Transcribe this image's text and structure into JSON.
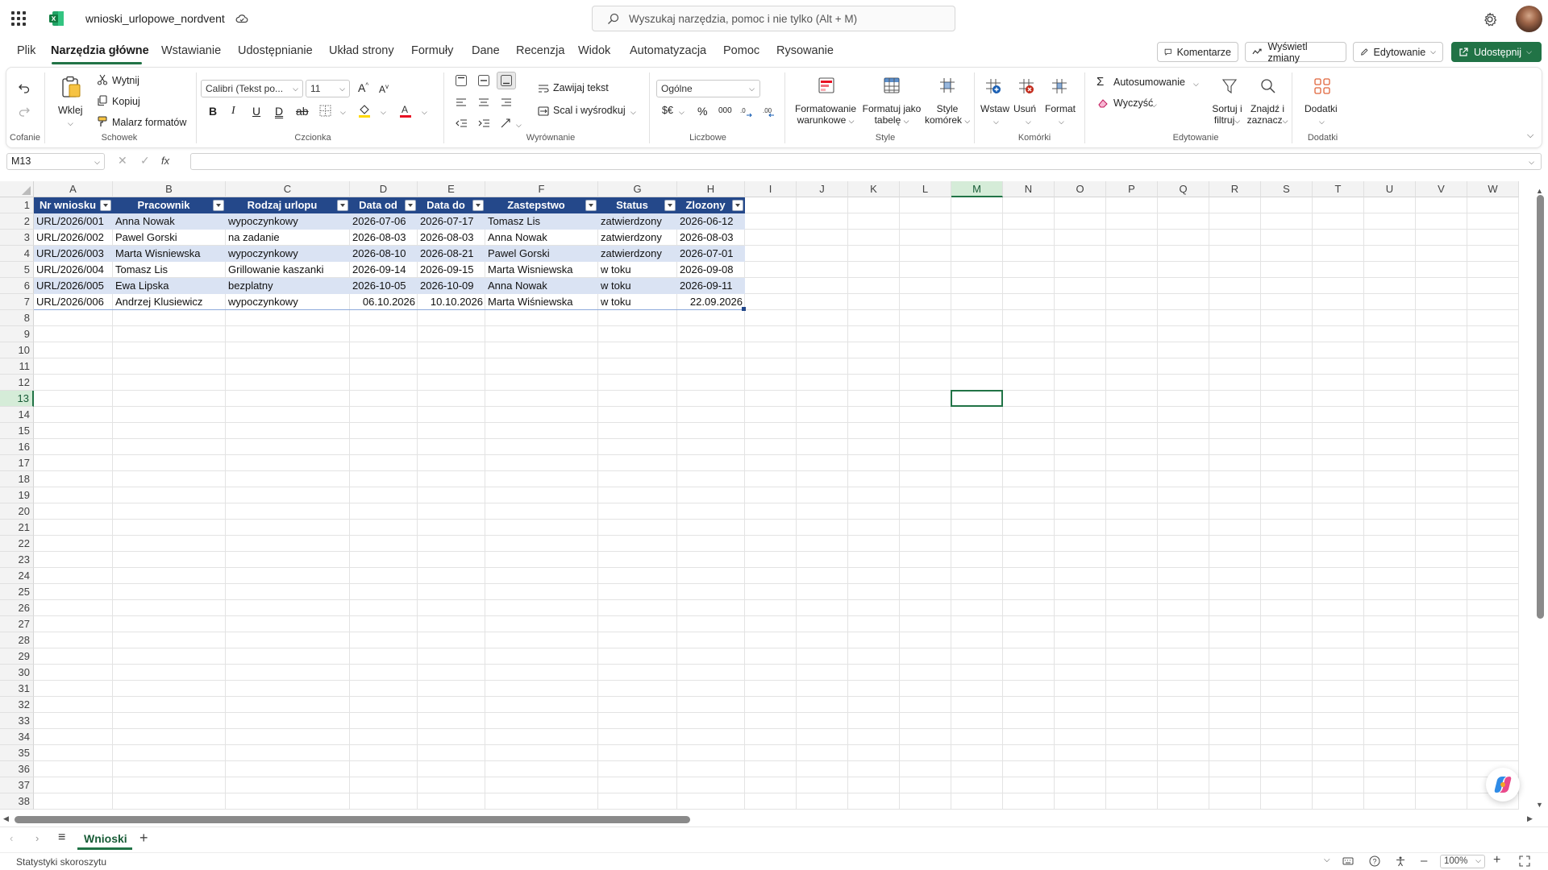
{
  "app": {
    "file_name": "wnioski_urlopowe_nordvent",
    "search_placeholder": "Wyszukaj narzędzia, pomoc i nie tylko (Alt + M)"
  },
  "menu_tabs": [
    "Plik",
    "Narzędzia główne",
    "Wstawianie",
    "Udostępnianie",
    "Układ strony",
    "Formuły",
    "Dane",
    "Recenzja",
    "Widok",
    "Automatyzacja",
    "Pomoc",
    "Rysowanie"
  ],
  "active_tab": "Narzędzia główne",
  "header_buttons": {
    "comments": "Komentarze",
    "show_changes": "Wyświetl zmiany",
    "editing": "Edytowanie",
    "share": "Udostępnij"
  },
  "ribbon": {
    "undo_group": "Cofanie",
    "clipboard": {
      "group": "Schowek",
      "paste": "Wklej",
      "cut": "Wytnij",
      "copy": "Kopiuj",
      "painter": "Malarz formatów"
    },
    "font": {
      "group": "Czcionka",
      "name": "Calibri (Tekst po...",
      "size": "11"
    },
    "alignment": {
      "group": "Wyrównanie",
      "wrap": "Zawijaj tekst",
      "merge": "Scal i wyśrodkuj"
    },
    "number": {
      "group": "Liczbowe",
      "format": "Ogólne",
      "currency": "$€",
      "percent": "%",
      "thousands": "000"
    },
    "styles": {
      "group": "Style",
      "conditional_1": "Formatowanie",
      "conditional_2": "warunkowe",
      "table_1": "Formatuj jako",
      "table_2": "tabelę",
      "cell_1": "Style",
      "cell_2": "komórek"
    },
    "cells": {
      "group": "Komórki",
      "insert": "Wstaw",
      "delete": "Usuń",
      "format": "Format"
    },
    "editing": {
      "group": "Edytowanie",
      "autosum": "Autosumowanie",
      "clear": "Wyczyść",
      "sort_1": "Sortuj i",
      "sort_2": "filtruj",
      "find_1": "Znajdź i",
      "find_2": "zaznacz"
    },
    "addins": {
      "group": "Dodatki",
      "label": "Dodatki"
    }
  },
  "formula_bar": {
    "name_box": "M13",
    "fx": "fx",
    "content": ""
  },
  "sheet": {
    "columns": [
      "A",
      "B",
      "C",
      "D",
      "E",
      "F",
      "G",
      "H",
      "I",
      "J",
      "K",
      "L",
      "M",
      "N",
      "O",
      "P",
      "Q",
      "R",
      "S",
      "T",
      "U",
      "V",
      "W"
    ],
    "selected_column": "M",
    "selected_row": 13,
    "row_count": 38,
    "table_headers": [
      "Nr wniosku",
      "Pracownik",
      "Rodzaj urlopu",
      "Data od",
      "Data do",
      "Zastepstwo",
      "Status",
      "Zlozony"
    ],
    "rows": [
      [
        "URL/2026/001",
        "Anna Nowak",
        "wypoczynkowy",
        "2026-07-06",
        "2026-07-17",
        "Tomasz Lis",
        "zatwierdzony",
        "2026-06-12"
      ],
      [
        "URL/2026/002",
        "Pawel Gorski",
        "na zadanie",
        "2026-08-03",
        "2026-08-03",
        "Anna Nowak",
        "zatwierdzony",
        "2026-08-03"
      ],
      [
        "URL/2026/003",
        "Marta Wisniewska",
        "wypoczynkowy",
        "2026-08-10",
        "2026-08-21",
        "Pawel Gorski",
        "zatwierdzony",
        "2026-07-01"
      ],
      [
        "URL/2026/004",
        "Tomasz Lis",
        "Grillowanie kaszanki",
        "2026-09-14",
        "2026-09-15",
        "Marta Wisniewska",
        "w toku",
        "2026-09-08"
      ],
      [
        "URL/2026/005",
        "Ewa Lipska",
        "bezplatny",
        "2026-10-05",
        "2026-10-09",
        "Anna Nowak",
        "w toku",
        "2026-09-11"
      ],
      [
        "URL/2026/006",
        "Andrzej Klusiewicz",
        "wypoczynkowy",
        "06.10.2026",
        "10.10.2026",
        "Marta Wiśniewska",
        "w toku",
        "22.09.2026"
      ]
    ],
    "right_aligned_rows": [
      5
    ]
  },
  "sheet_tabs": [
    "Wnioski"
  ],
  "status_bar": {
    "left": "Statystyki skoroszytu",
    "zoom": "100%"
  },
  "colors": {
    "accent": "#217346",
    "table_header": "#24488a",
    "band": "#dae3f3"
  }
}
